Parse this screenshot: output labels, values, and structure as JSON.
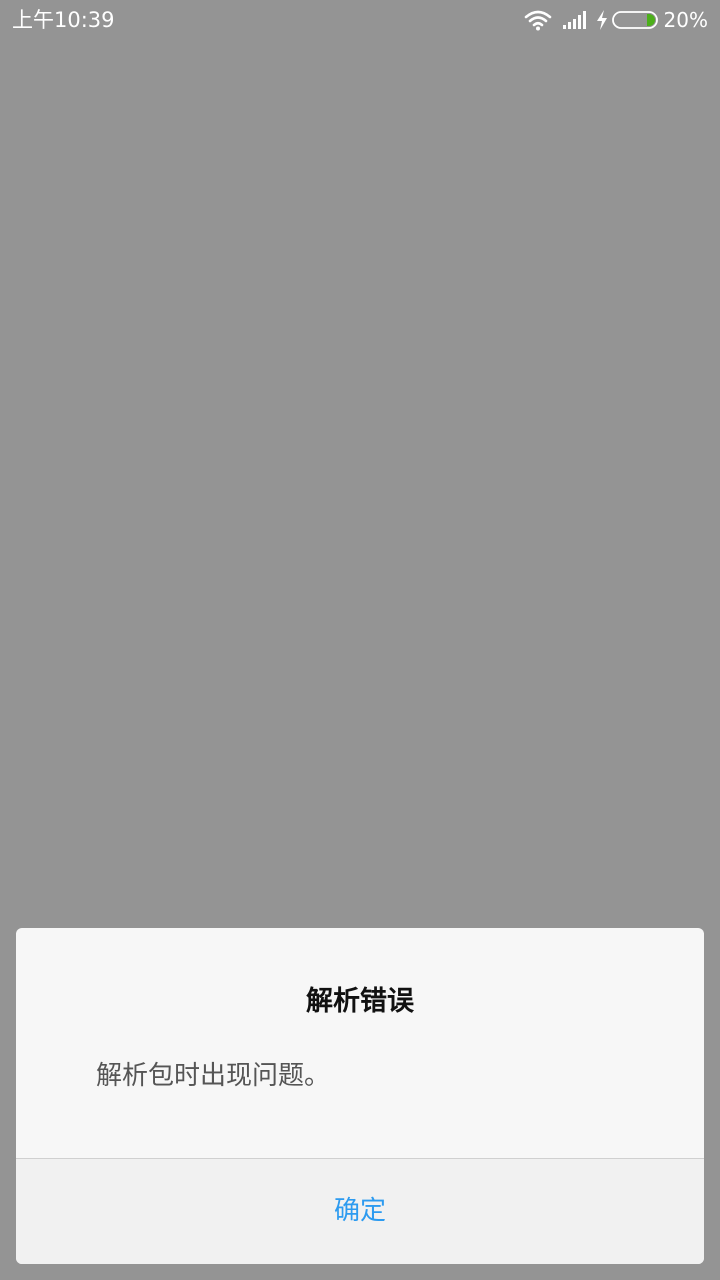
{
  "status_bar": {
    "time": "上午10:39",
    "battery_percent": "20%",
    "battery_level": 0.2,
    "icons": [
      "wifi-icon",
      "signal-icon",
      "charging-icon",
      "battery-icon"
    ],
    "battery_fill_color": "#4caf1a"
  },
  "dialog": {
    "title": "解析错误",
    "message": "解析包时出现问题。",
    "confirm_label": "确定",
    "confirm_color": "#2d9bf0"
  }
}
